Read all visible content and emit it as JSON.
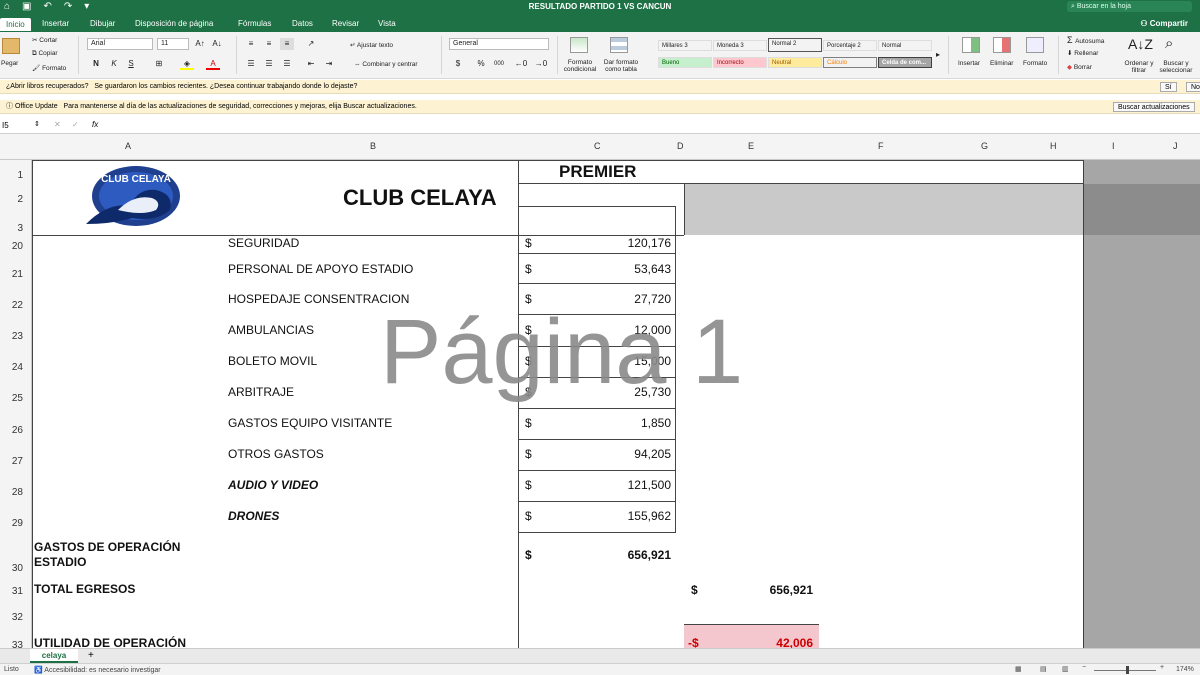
{
  "title_bar": {
    "doc_title": "RESULTADO PARTIDO 1 VS CANCUN",
    "search_placeholder": "Buscar en la hoja"
  },
  "tabs": [
    "Inicio",
    "Insertar",
    "Dibujar",
    "Disposición de página",
    "Fórmulas",
    "Datos",
    "Revisar",
    "Vista"
  ],
  "share_label": "Compartir",
  "ribbon": {
    "paste": "Pegar",
    "cut": "Cortar",
    "copy": "Copiar",
    "format_painter": "Formato",
    "font_name": "Arial",
    "font_size": "11",
    "bold": "N",
    "italic": "K",
    "underline": "S",
    "wrap_text": "Ajustar texto",
    "merge_center": "Combinar y centrar",
    "number_format": "General",
    "currency": "$",
    "percent": "%",
    "thousands": "000",
    "conditional_format": "Formato condicional",
    "format_as_table": "Dar formato como tabla",
    "styles": [
      {
        "label": "Millares 3",
        "bg": "#ffffff"
      },
      {
        "label": "Moneda 3",
        "bg": "#ffffff"
      },
      {
        "label": "Normal 2",
        "bg": "#ffffff"
      },
      {
        "label": "Porcentaje 2",
        "bg": "#ffffff"
      },
      {
        "label": "Normal",
        "bg": "#ffffff"
      },
      {
        "label": "Bueno",
        "bg": "#c6efce"
      },
      {
        "label": "Incorrecto",
        "bg": "#ffc7ce"
      },
      {
        "label": "Neutral",
        "bg": "#ffeb9c"
      },
      {
        "label": "Cálculo",
        "bg": "#f2f2f2"
      },
      {
        "label": "Celda de com...",
        "bg": "#a5a5a5"
      }
    ],
    "insert": "Insertar",
    "delete": "Eliminar",
    "format": "Formato",
    "autosum": "Autosuma",
    "fill": "Rellenar",
    "clear": "Borrar",
    "sort_filter": "Ordenar y filtrar",
    "find_select": "Buscar y seleccionar"
  },
  "recovery_bar": {
    "heading": "¿Abrir libros recuperados?",
    "message": "Se guardaron los cambios recientes. ¿Desea continuar trabajando donde lo dejaste?",
    "yes": "Sí",
    "no": "No"
  },
  "update_bar": {
    "heading": "Office Update",
    "message": "Para mantenerse al día de las actualizaciones de seguridad, correcciones y mejoras, elija Buscar actualizaciones.",
    "button": "Buscar actualizaciones"
  },
  "formula_bar": {
    "name_box": "I5",
    "fx": "fx",
    "value": ""
  },
  "columns": [
    "A",
    "B",
    "C",
    "D",
    "E",
    "F",
    "G",
    "H",
    "I",
    "J"
  ],
  "rows": [
    "1",
    "2",
    "3",
    "20",
    "21",
    "22",
    "23",
    "24",
    "25",
    "26",
    "27",
    "28",
    "29",
    "30",
    "31",
    "32",
    "33"
  ],
  "sheet": {
    "logo_text": "CLUB CELAYA",
    "title": "CLUB CELAYA",
    "premier": "PREMIER",
    "line_items": [
      {
        "label": "SEGURIDAD",
        "currency": "$",
        "amount": "120,176",
        "italic": false
      },
      {
        "label": "PERSONAL DE APOYO ESTADIO",
        "currency": "$",
        "amount": "53,643",
        "italic": false
      },
      {
        "label": "HOSPEDAJE CONSENTRACION",
        "currency": "$",
        "amount": "27,720",
        "italic": false
      },
      {
        "label": "AMBULANCIAS",
        "currency": "$",
        "amount": "12,000",
        "italic": false
      },
      {
        "label": "BOLETO MOVIL",
        "currency": "$",
        "amount": "15,000",
        "italic": false
      },
      {
        "label": "ARBITRAJE",
        "currency": "$",
        "amount": "25,730",
        "italic": false
      },
      {
        "label": "GASTOS EQUIPO VISITANTE",
        "currency": "$",
        "amount": "1,850",
        "italic": false
      },
      {
        "label": "OTROS GASTOS",
        "currency": "$",
        "amount": "94,205",
        "italic": false
      },
      {
        "label": "AUDIO Y VIDEO",
        "currency": "$",
        "amount": "121,500",
        "italic": true
      },
      {
        "label": "DRONES",
        "currency": "$",
        "amount": "155,962",
        "italic": true
      }
    ],
    "gastos_label_1": "GASTOS DE OPERACIÓN",
    "gastos_label_2": "ESTADIO",
    "gastos_currency": "$",
    "gastos_total": "656,921",
    "total_egresos_label": "TOTAL EGRESOS",
    "total_egresos_currency": "$",
    "total_egresos": "656,921",
    "utilidad_label": "UTILIDAD DE OPERACIÓN",
    "utilidad_currency": "-$",
    "utilidad": "42,006"
  },
  "watermark": "Página 1",
  "sheet_tab": "celaya",
  "status": {
    "ready": "Listo",
    "accessibility": "Accesibilidad: es necesario investigar",
    "zoom": "174%"
  },
  "colors": {
    "excel_green": "#1e7145",
    "negative_fill": "#f4c7ce",
    "gray_fill": "#a6a6a6"
  }
}
